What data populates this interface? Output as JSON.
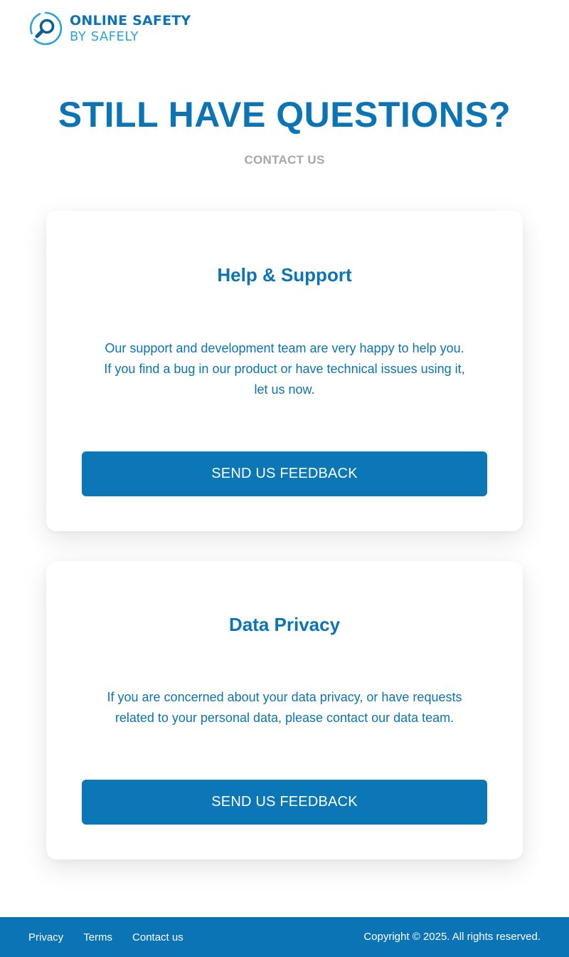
{
  "brand": {
    "line1": "ONLINE SAFETY",
    "line2": "BY SAFELY",
    "icon": "magnifier-logo-icon",
    "color_primary": "#0b74b5",
    "color_secondary": "#29a3dd"
  },
  "hero": {
    "title": "STILL HAVE QUESTIONS?",
    "subtitle": "CONTACT US"
  },
  "cards": [
    {
      "title": "Help & Support",
      "body_lines": [
        "Our support and development team are very happy to help you.",
        "If you find a bug in our product or have technical issues using it,",
        "let us now."
      ],
      "button_label": "SEND US FEEDBACK"
    },
    {
      "title": "Data Privacy",
      "body_lines": [
        "If you are concerned about your data privacy, or have requests",
        "related to your personal data, please contact our data team."
      ],
      "button_label": "SEND US FEEDBACK"
    }
  ],
  "footer": {
    "links": [
      "Privacy",
      "Terms",
      "Contact us"
    ],
    "copyright": "Copyright © 2025. All rights reserved."
  },
  "colors": {
    "accent": "#0b74b5",
    "button": "#0b77b6",
    "muted": "#a7a7a7"
  }
}
